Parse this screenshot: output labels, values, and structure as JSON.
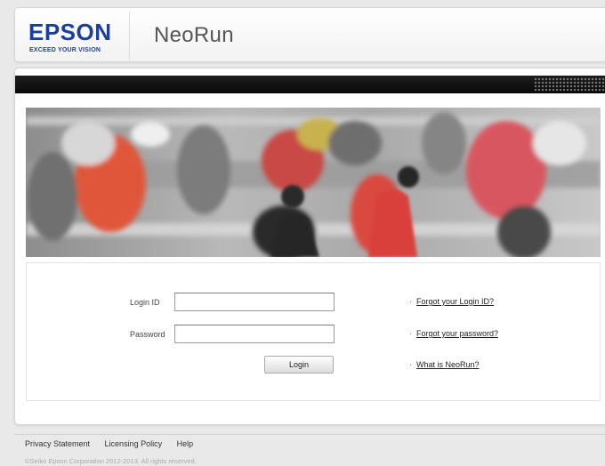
{
  "header": {
    "logo_text": "EPSON",
    "logo_tagline": "EXCEED YOUR VISION",
    "app_name": "NeoRun"
  },
  "login": {
    "login_id_label": "Login ID",
    "login_id_value": "",
    "password_label": "Password",
    "password_value": "",
    "submit_label": "Login"
  },
  "links": {
    "forgot_login_id": "Forgot your Login ID?",
    "forgot_password": "Forgot your password?",
    "what_is": "What is NeoRun?"
  },
  "footer": {
    "links": [
      "Privacy Statement",
      "Licensing Policy",
      "Help"
    ],
    "copyright": "©Seiko Epson Corporation 2012-2013. All rights reserved."
  },
  "colors": {
    "brand_blue": "#1b3f9a",
    "top_bar": "#111111",
    "background": "#e9e9e9"
  }
}
